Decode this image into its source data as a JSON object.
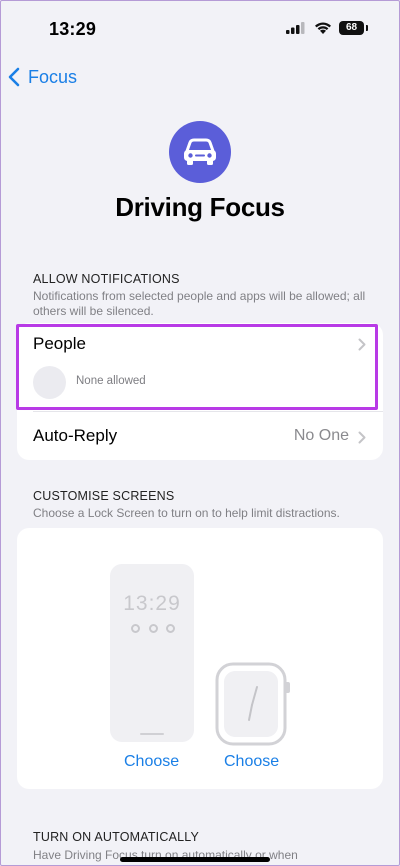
{
  "status_bar": {
    "time": "13:29",
    "battery": "68"
  },
  "nav": {
    "back_label": "Focus"
  },
  "header": {
    "title": "Driving Focus",
    "icon": "car-icon"
  },
  "allow_notifications": {
    "header": "ALLOW NOTIFICATIONS",
    "description": "Notifications from selected people and apps will be allowed; all others will be silenced.",
    "people": {
      "label": "People",
      "status": "None allowed"
    },
    "auto_reply": {
      "label": "Auto-Reply",
      "value": "No One"
    }
  },
  "customise_screens": {
    "header": "CUSTOMISE SCREENS",
    "description": "Choose a Lock Screen to turn on to help limit distractions.",
    "lock_screen_time": "13:29",
    "lock_choose_label": "Choose",
    "watch_choose_label": "Choose"
  },
  "turn_on_automatically": {
    "header": "TURN ON AUTOMATICALLY",
    "description": "Have Driving Focus turn on automatically or when"
  },
  "colors": {
    "accent": "#1a7fe6",
    "focus_icon_bg": "#5b5ed9",
    "highlight": "#b83ae6"
  }
}
